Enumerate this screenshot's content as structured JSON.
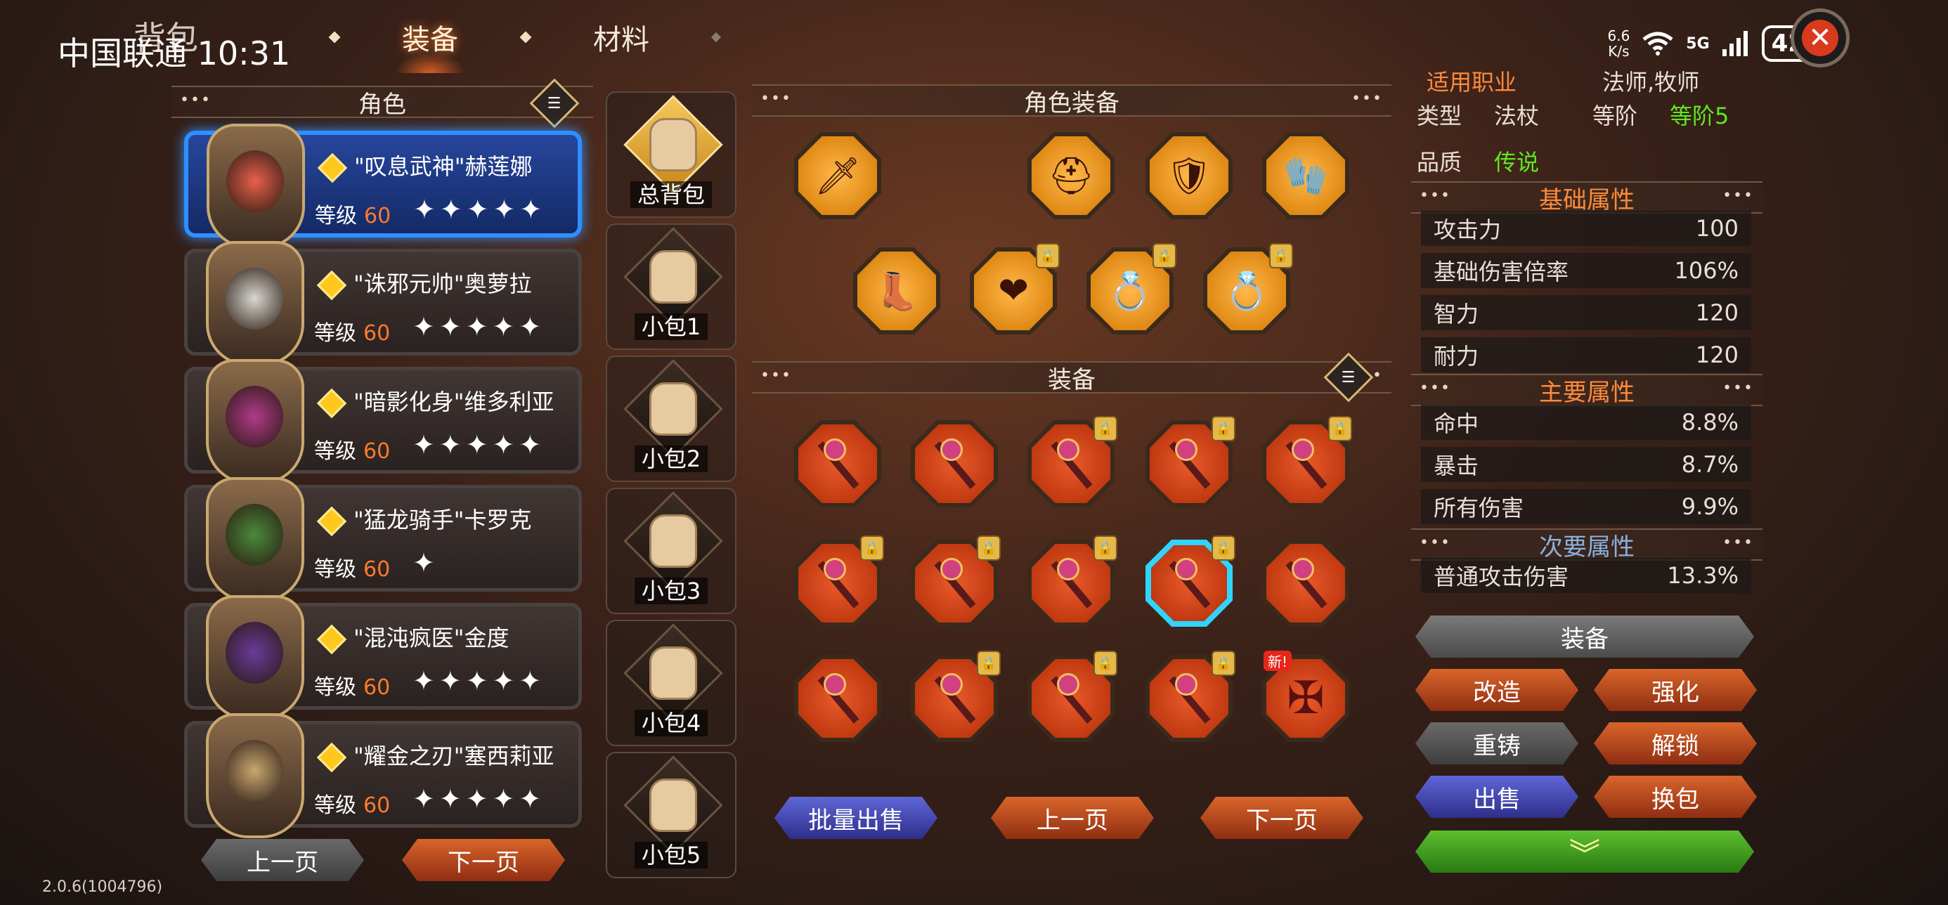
{
  "status_bar": {
    "page_title": "背包",
    "carrier_time": "中国联通 10:31",
    "net_speed_top": "6.6",
    "net_speed_bottom": "K/s",
    "net_type": "5G",
    "battery": "42"
  },
  "tabs": [
    {
      "label": "装备",
      "active": true
    },
    {
      "label": "材料",
      "active": false
    }
  ],
  "characters_panel": {
    "header": "角色",
    "characters": [
      {
        "name": "\"叹息武神\"赫莲娜",
        "level_label": "等级",
        "level": "60",
        "stars": 5,
        "selected": true,
        "face_color": "#e8604a"
      },
      {
        "name": "\"诛邪元帅\"奥萝拉",
        "level_label": "等级",
        "level": "60",
        "stars": 5,
        "selected": false,
        "face_color": "#d8d8d0"
      },
      {
        "name": "\"暗影化身\"维多利亚",
        "level_label": "等级",
        "level": "60",
        "stars": 5,
        "selected": false,
        "face_color": "#b03a8a"
      },
      {
        "name": "\"猛龙骑手\"卡罗克",
        "level_label": "等级",
        "level": "60",
        "stars": 1,
        "selected": false,
        "face_color": "#4a8a3a"
      },
      {
        "name": "\"混沌疯医\"金度",
        "level_label": "等级",
        "level": "60",
        "stars": 5,
        "selected": false,
        "face_color": "#6a3a9a"
      },
      {
        "name": "\"耀金之刃\"塞西莉亚",
        "level_label": "等级",
        "level": "60",
        "stars": 5,
        "selected": false,
        "face_color": "#c8a870"
      }
    ],
    "prev_page": "上一页",
    "next_page": "下一页"
  },
  "bags": [
    {
      "label": "总背包",
      "active": true
    },
    {
      "label": "小包1",
      "active": false
    },
    {
      "label": "小包2",
      "active": false
    },
    {
      "label": "小包3",
      "active": false
    },
    {
      "label": "小包4",
      "active": false
    },
    {
      "label": "小包5",
      "active": false
    }
  ],
  "character_equipment": {
    "header": "角色装备",
    "row1": [
      "sword-icon",
      "hood-icon",
      "armor-icon",
      "gloves-icon"
    ],
    "row2": [
      "boots-icon",
      "necklace-icon",
      "ring-red-icon",
      "ring-blue-icon"
    ]
  },
  "inventory": {
    "header": "装备",
    "items": [
      {
        "icon": "staff-icon",
        "locked": false,
        "selected": false,
        "new": false
      },
      {
        "icon": "staff-icon",
        "locked": false,
        "selected": false,
        "new": false
      },
      {
        "icon": "staff-icon",
        "locked": true,
        "selected": false,
        "new": false
      },
      {
        "icon": "staff-icon",
        "locked": true,
        "selected": false,
        "new": false
      },
      {
        "icon": "staff-icon",
        "locked": true,
        "selected": false,
        "new": false
      },
      {
        "icon": "staff-icon",
        "locked": true,
        "selected": false,
        "new": false
      },
      {
        "icon": "staff-icon",
        "locked": true,
        "selected": false,
        "new": false
      },
      {
        "icon": "staff-icon",
        "locked": true,
        "selected": false,
        "new": false
      },
      {
        "icon": "staff-icon",
        "locked": true,
        "selected": true,
        "new": false
      },
      {
        "icon": "staff-icon",
        "locked": false,
        "selected": false,
        "new": false
      },
      {
        "icon": "staff-icon",
        "locked": false,
        "selected": false,
        "new": false
      },
      {
        "icon": "staff-icon",
        "locked": true,
        "selected": false,
        "new": false
      },
      {
        "icon": "staff-icon",
        "locked": true,
        "selected": false,
        "new": false
      },
      {
        "icon": "staff-icon",
        "locked": true,
        "selected": false,
        "new": false
      },
      {
        "icon": "shield-icon",
        "locked": false,
        "selected": false,
        "new": true
      }
    ],
    "new_tag": "新!",
    "batch_sell": "批量出售",
    "prev_page": "上一页",
    "next_page": "下一页"
  },
  "details": {
    "job_label": "适用职业",
    "job_value": "法师,牧师",
    "type_label": "类型",
    "type_value": "法杖",
    "grade_label": "等阶",
    "grade_value": "等阶5",
    "quality_label": "品质",
    "quality_value": "传说",
    "basic_header": "基础属性",
    "basic": [
      {
        "name": "攻击力",
        "value": "100"
      },
      {
        "name": "基础伤害倍率",
        "value": "106%"
      },
      {
        "name": "智力",
        "value": "120"
      },
      {
        "name": "耐力",
        "value": "120"
      }
    ],
    "main_header": "主要属性",
    "main": [
      {
        "name": "命中",
        "value": "8.8%"
      },
      {
        "name": "暴击",
        "value": "8.7%"
      },
      {
        "name": "所有伤害",
        "value": "9.9%"
      }
    ],
    "secondary_header": "次要属性",
    "secondary": [
      {
        "name": "普通攻击伤害",
        "value": "13.3%"
      }
    ]
  },
  "actions": {
    "equip": "装备",
    "reforge": "改造",
    "enhance": "强化",
    "recast": "重铸",
    "unlock": "解锁",
    "sell": "出售",
    "swap_bag": "换包"
  },
  "version": "2.0.6(1004796)"
}
